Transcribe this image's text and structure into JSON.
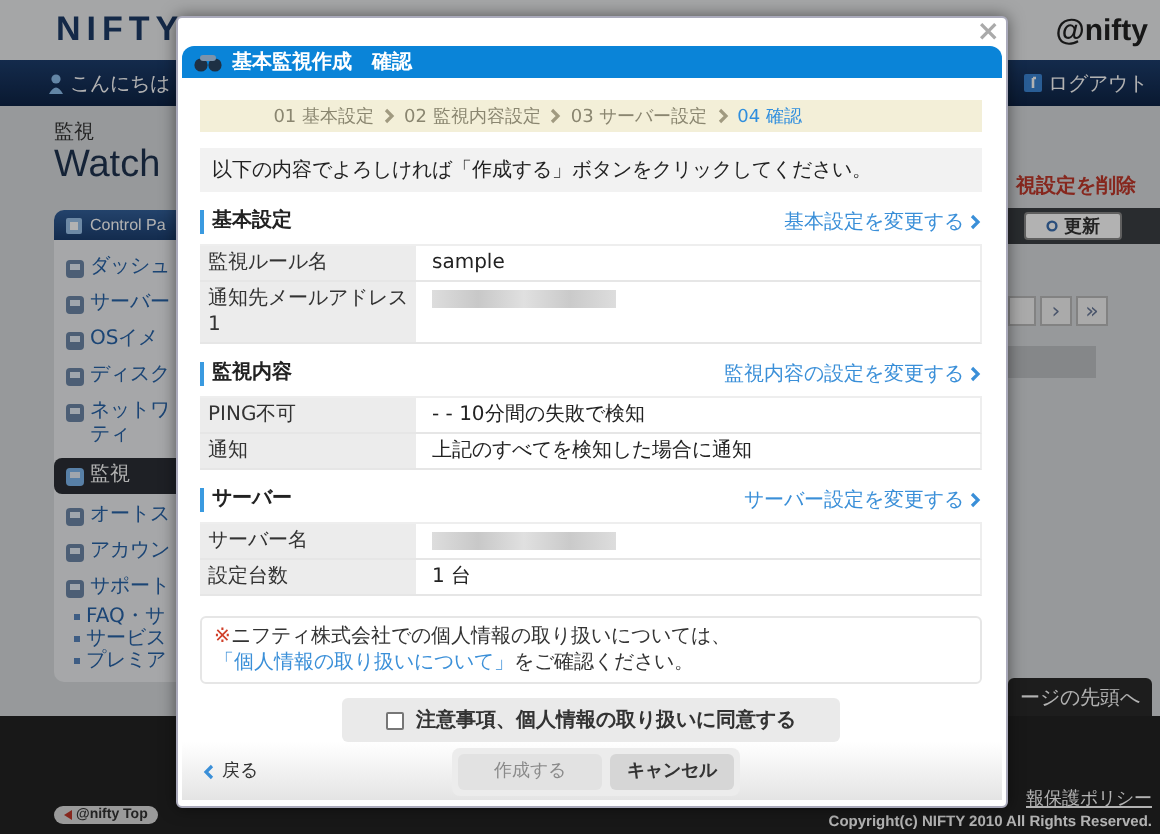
{
  "header": {
    "logo": "NIFTY",
    "brand": "@nifty"
  },
  "nav": {
    "greeting": "こんにちは",
    "logout": "ログアウト"
  },
  "page_heading": {
    "label": "監視",
    "title": "Watch"
  },
  "control_panel": {
    "title": "Control Pa",
    "items": [
      {
        "lines": [
          "ダッシュ"
        ],
        "selected": false
      },
      {
        "lines": [
          "サーバー"
        ],
        "selected": false
      },
      {
        "lines": [
          "OSイメ"
        ],
        "selected": false
      },
      {
        "lines": [
          "ディスク"
        ],
        "selected": false
      },
      {
        "lines": [
          "ネットワ",
          "ティ"
        ],
        "selected": false
      },
      {
        "lines": [
          "監視"
        ],
        "selected": true
      },
      {
        "lines": [
          "オートス"
        ],
        "selected": false
      },
      {
        "lines": [
          "アカウン"
        ],
        "selected": false
      },
      {
        "lines": [
          "サポート"
        ],
        "selected": false
      }
    ],
    "links": [
      "FAQ・サ",
      "サービス",
      "プレミア"
    ]
  },
  "right_panel": {
    "delete_link": "視設定を削除",
    "refresh_button": "更新",
    "pager": [
      "›",
      "»"
    ],
    "page_top": "ージの先頭へ"
  },
  "footer": {
    "badges": [
      "@nifty Top"
    ],
    "policy_link": "報保護ポリシー",
    "copyright": "Copyright(c) NIFTY 2010 All Rights Reserved."
  },
  "dialog": {
    "close": "×",
    "title": "基本監視作成　確認",
    "steps": [
      {
        "label": "01 基本設定",
        "selected": false
      },
      {
        "label": "02 監視内容設定",
        "selected": false
      },
      {
        "label": "03 サーバー設定",
        "selected": false
      },
      {
        "label": "04 確認",
        "selected": true
      }
    ],
    "intro": "以下の内容でよろしければ「作成する」ボタンをクリックしてください。",
    "sections": [
      {
        "heading": "基本設定",
        "edit_link": "基本設定を変更する",
        "rows": [
          {
            "label": "監視ルール名",
            "kind": "text",
            "value": "sample"
          },
          {
            "label": "通知先メールアドレス1",
            "kind": "redacted"
          }
        ]
      },
      {
        "heading": "監視内容",
        "edit_link": "監視内容の設定を変更する",
        "rows": [
          {
            "label": "PING不可",
            "kind": "text",
            "value": "- - 10分間の失敗で検知"
          },
          {
            "label": "通知",
            "kind": "text",
            "value": "上記のすべてを検知した場合に通知"
          }
        ]
      },
      {
        "heading": "サーバー",
        "edit_link": "サーバー設定を変更する",
        "rows": [
          {
            "label": "サーバー名",
            "kind": "redacted"
          },
          {
            "label": "設定台数",
            "kind": "text",
            "value": "1 台"
          }
        ]
      }
    ],
    "notice": {
      "mark": "※",
      "before": "ニフティ株式会社での個人情報の取り扱いについては、",
      "link": "「個人情報の取り扱いについて」",
      "after": "をご確認ください。"
    },
    "agree": {
      "label": "注意事項、個人情報の取り扱いに同意する",
      "checked": false
    },
    "back": "戻る",
    "submit": {
      "label": "作成する",
      "disabled": true
    },
    "cancel": "キャンセル"
  }
}
